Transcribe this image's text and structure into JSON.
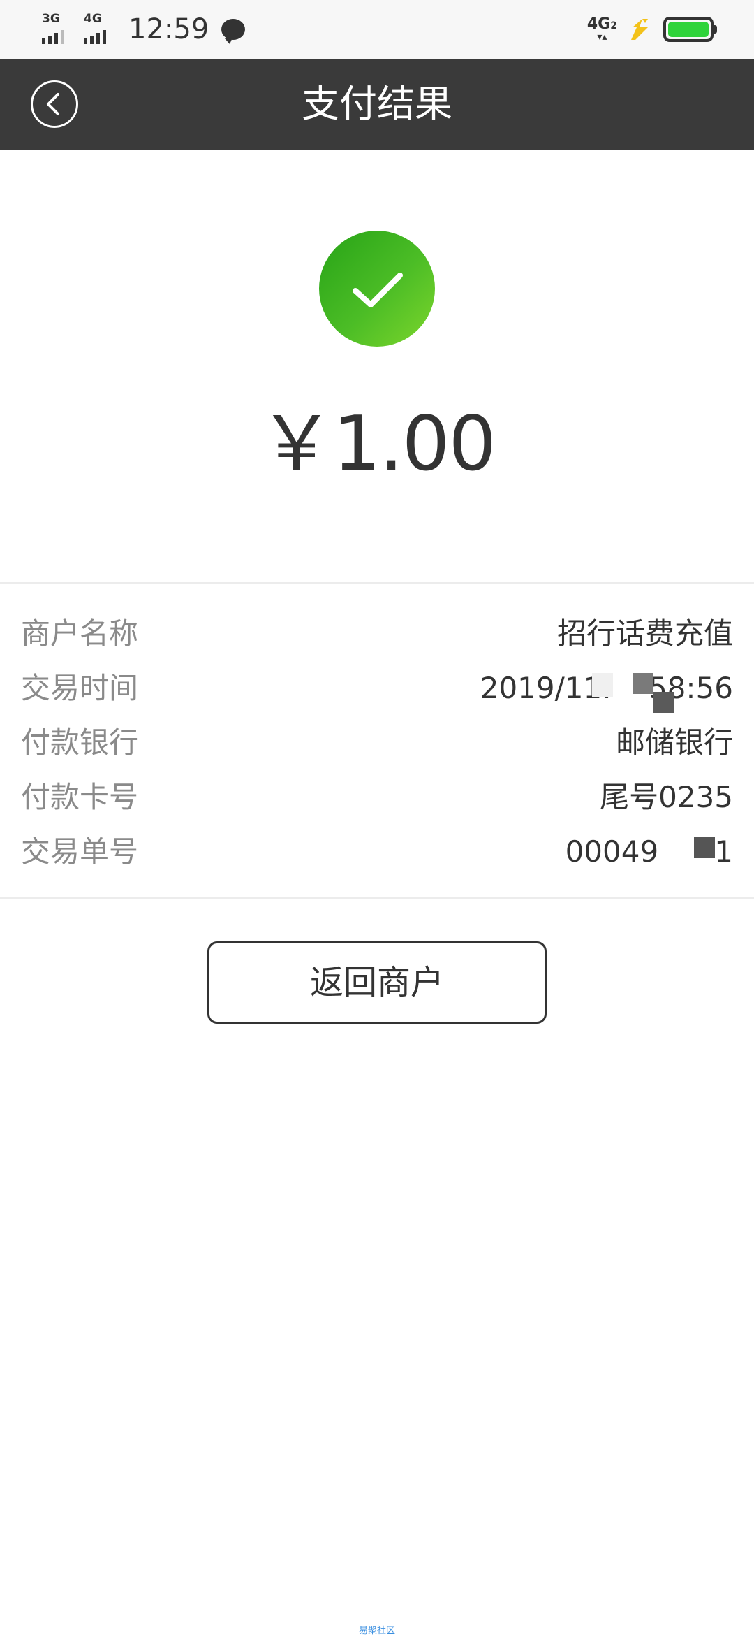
{
  "status_bar": {
    "sim1_network": "3G",
    "sim2_network": "4G",
    "time": "12:59",
    "right_network": "4G",
    "right_network_sub": "2",
    "battery_color": "#2fd33a"
  },
  "header": {
    "title": "支付结果",
    "back_icon": "back-chevron-icon",
    "background": "#3a3a3a"
  },
  "result": {
    "status_icon": "check-circle-icon",
    "accent_color": "#3bb31f",
    "amount": "￥1.00"
  },
  "details": [
    {
      "label": "商户名称",
      "value": "招行话费充值"
    },
    {
      "label": "交易时间",
      "value": "2019/11.    58:56"
    },
    {
      "label": "付款银行",
      "value": "邮储银行"
    },
    {
      "label": "付款卡号",
      "value": "尾号0235"
    },
    {
      "label": "交易单号",
      "value": "00049      1"
    }
  ],
  "actions": {
    "return_label": "返回商户"
  },
  "footer": {
    "watermark": "易聚社区"
  }
}
